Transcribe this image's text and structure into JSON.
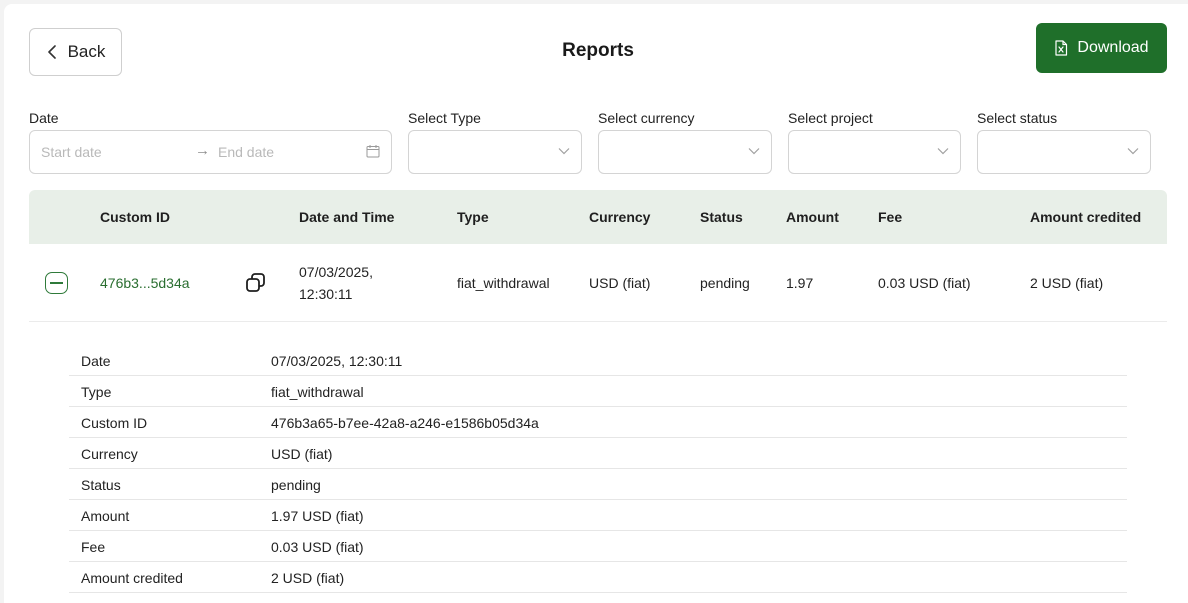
{
  "header": {
    "back_label": "Back",
    "title": "Reports",
    "download_label": "Download"
  },
  "filters": {
    "date_label": "Date",
    "start_placeholder": "Start date",
    "end_placeholder": "End date",
    "type_label": "Select Type",
    "currency_label": "Select currency",
    "project_label": "Select project",
    "status_label": "Select status"
  },
  "table": {
    "columns": [
      "Custom ID",
      "Date and Time",
      "Type",
      "Currency",
      "Status",
      "Amount",
      "Fee",
      "Amount credited"
    ],
    "row": {
      "custom_id": "476b3...5d34a",
      "date_line1": "07/03/2025,",
      "date_line2": "12:30:11",
      "type": "fiat_withdrawal",
      "currency": "USD (fiat)",
      "status": "pending",
      "amount": "1.97",
      "fee": "0.03 USD (fiat)",
      "amount_credited": "2 USD (fiat)"
    }
  },
  "details": [
    {
      "key": "Date",
      "value": "07/03/2025, 12:30:11"
    },
    {
      "key": "Type",
      "value": "fiat_withdrawal"
    },
    {
      "key": "Custom ID",
      "value": "476b3a65-b7ee-42a8-a246-e1586b05d34a"
    },
    {
      "key": "Currency",
      "value": "USD (fiat)"
    },
    {
      "key": "Status",
      "value": "pending"
    },
    {
      "key": "Amount",
      "value": "1.97 USD (fiat)"
    },
    {
      "key": "Fee",
      "value": "0.03 USD (fiat)"
    },
    {
      "key": "Amount credited",
      "value": "2 USD (fiat)"
    }
  ],
  "colors": {
    "accent": "#1f6f2a",
    "header_bg": "#e8efe8",
    "link": "#2a6e30"
  }
}
